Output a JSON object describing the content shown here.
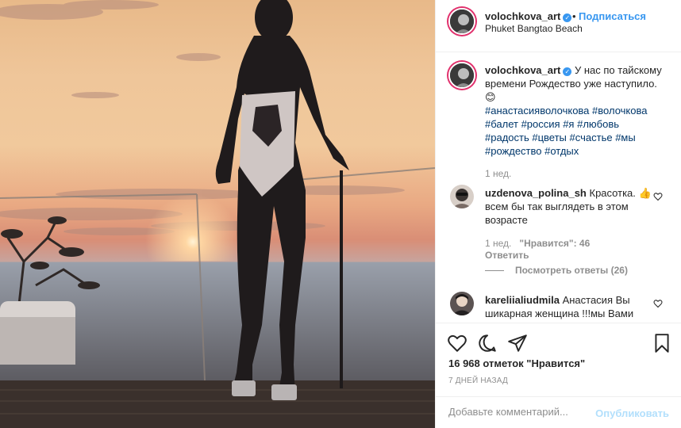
{
  "post": {
    "username": "volochkova_art",
    "verified_icon": "verified-badge-icon",
    "follow_label": "Подписаться",
    "separator": "•",
    "location": "Phuket Bangtao Beach",
    "caption_text": "У нас по тайскому времени Рождество уже наступило.😊",
    "hashtags": [
      "#анастасияволочкова",
      "#волочкова",
      "#балет",
      "#россия",
      "#я",
      "#любовь",
      "#радость",
      "#цветы",
      "#счастье",
      "#мы",
      "#рождество",
      "#отдых"
    ],
    "caption_time": "1 нед.",
    "likes": "16 968 отметок \"Нравится\"",
    "date": "7 ДНЕЙ НАЗАД"
  },
  "comments": [
    {
      "username": "uzdenova_polina_sh",
      "text": "Красотка. 👍всем бы так выглядеть в этом возрасте",
      "time": "1 нед.",
      "likes": "\"Нравится\": 46",
      "reply_label": "Ответить",
      "view_replies": "Посмотреть ответы (26)"
    },
    {
      "username": "kareliialiudmila",
      "text": "Анастасия Вы шикарная женщина !!!мы Вами"
    }
  ],
  "comment_box": {
    "placeholder": "Добавьте комментарий...",
    "publish_label": "Опубликовать"
  },
  "icons": {
    "like": "heart-icon",
    "comment": "comment-icon",
    "share": "share-icon",
    "save": "bookmark-icon"
  },
  "colors": {
    "accent": "#3897f0",
    "hashtag": "#00376b",
    "muted": "#8e8e8e",
    "publish_disabled": "#b2dffc"
  }
}
